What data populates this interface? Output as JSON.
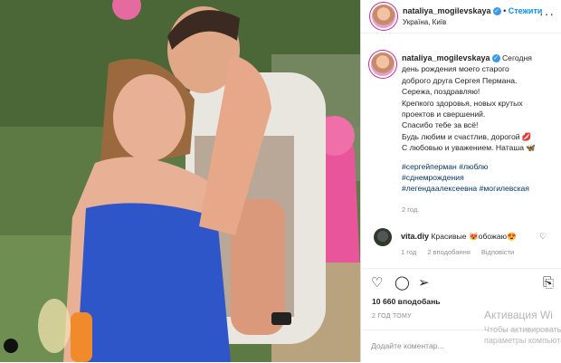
{
  "post": {
    "username": "nataliya_mogilevskaya",
    "follow_label": "Стежити",
    "location": "Україна, Київ",
    "caption_lines": [
      "Сегодня",
      "день рождения моего старого",
      "доброго друга Сергея Пермана.",
      "Сережа, поздравляю!",
      "Крепкого здоровья, новых крутых",
      "проектов и свершений.",
      "Спасибо тебе за всё!",
      "Будь любим и счастлив, дорогой 💋",
      "С любовью и уважением. Наташа 🦋"
    ],
    "hashtags": [
      "#сергейперман",
      "#люблю",
      "#сднемрождения",
      "#легендаалексеевна",
      "#могилевская"
    ],
    "caption_time": "2 год.",
    "likes": "10 660 вподобань",
    "posted_ago": "2 ГОД ТОМУ",
    "add_comment_placeholder": "Додайте коментар..."
  },
  "comment": {
    "username": "vita.diy",
    "text": "Красивые 😻обожаю😍",
    "time": "1 год",
    "likes": "2 вподобання",
    "reply": "Відповісти"
  },
  "watermark": {
    "title": "Активация Wi",
    "line1": "Чтобы активировать",
    "line2": "параметры компьюте"
  },
  "icons": {
    "more": "more-icon",
    "like": "heart-icon",
    "comment": "comment-icon",
    "share": "share-icon",
    "save": "bookmark-icon"
  },
  "colors": {
    "link": "#0095f6",
    "hashtag": "#00376b",
    "muted": "#8e8e8e"
  }
}
